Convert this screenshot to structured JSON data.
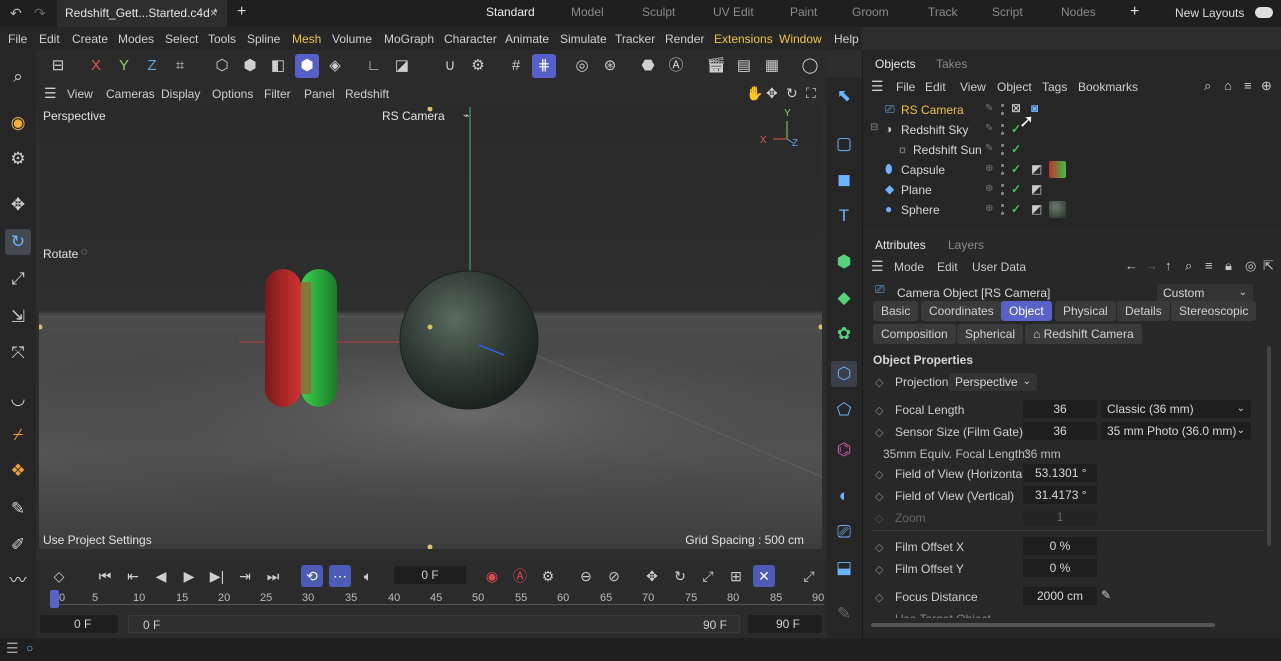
{
  "titlebar": {
    "doc_tab": "Redshift_Gett...Started.c4d *",
    "close": "×",
    "add": "+",
    "workspaces": [
      "Standard",
      "Model",
      "Sculpt",
      "UV Edit",
      "Paint",
      "Groom",
      "Track",
      "Script",
      "Nodes"
    ],
    "active_workspace": "Standard",
    "new_layouts": "New Layouts"
  },
  "menubar": [
    "File",
    "Edit",
    "Create",
    "Modes",
    "Select",
    "Tools",
    "Spline",
    "Mesh",
    "Volume",
    "MoGraph",
    "Character",
    "Animate",
    "Simulate",
    "Tracker",
    "Render",
    "Extensions",
    "Window",
    "Help"
  ],
  "viewport": {
    "menus": [
      "View",
      "Cameras",
      "Display",
      "Options",
      "Filter",
      "Panel",
      "Redshift"
    ],
    "label": "Perspective",
    "camera": "RS Camera",
    "hud_rotate": "Rotate",
    "projection_note": "Use Project Settings",
    "grid_spacing": "Grid Spacing : 500 cm",
    "axis": {
      "x": "X",
      "y": "Y",
      "z": "Z"
    },
    "toolbar_axes": [
      "X",
      "Y",
      "Z"
    ]
  },
  "timeline": {
    "current_frame": "0 F",
    "start": "0 F",
    "preview_start": "0 F",
    "preview_end": "90 F",
    "end": "90 F",
    "ruler": [
      "0",
      "5",
      "10",
      "15",
      "20",
      "25",
      "30",
      "35",
      "40",
      "45",
      "50",
      "55",
      "60",
      "65",
      "70",
      "75",
      "80",
      "85",
      "90"
    ]
  },
  "objects_panel": {
    "tabs": [
      "Objects",
      "Takes"
    ],
    "menus": [
      "File",
      "Edit",
      "View",
      "Object",
      "Tags",
      "Bookmarks"
    ],
    "rows": [
      {
        "name": "RS Camera",
        "selected": true
      },
      {
        "name": "Redshift Sky"
      },
      {
        "name": "Redshift Sun"
      },
      {
        "name": "Capsule"
      },
      {
        "name": "Plane"
      },
      {
        "name": "Sphere"
      }
    ]
  },
  "attributes_panel": {
    "tabs": [
      "Attributes",
      "Layers"
    ],
    "menus": [
      "Mode",
      "Edit",
      "User Data"
    ],
    "object_title": "Camera Object [RS Camera]",
    "preset": "Custom",
    "tab_buttons_row1": [
      "Basic",
      "Coordinates",
      "Object",
      "Physical",
      "Details",
      "Stereoscopic"
    ],
    "active_tab": "Object",
    "tab_buttons_row2": [
      "Composition",
      "Spherical",
      "Redshift Camera"
    ],
    "section": "Object Properties",
    "projection_label": "Projection",
    "projection_value": "Perspective",
    "focal_length_label": "Focal Length",
    "focal_length": "36",
    "focal_preset": "Classic (36 mm)",
    "sensor_label": "Sensor Size (Film Gate)",
    "sensor": "36",
    "sensor_preset": "35 mm Photo (36.0 mm)",
    "equiv_label": "35mm Equiv. Focal Length:",
    "equiv_value": "36 mm",
    "fov_h_label": "Field of View (Horizontal)",
    "fov_h": "53.1301 °",
    "fov_v_label": "Field of View (Vertical)",
    "fov_v": "31.4173 °",
    "zoom_label": "Zoom",
    "zoom": "1",
    "film_x_label": "Film Offset X",
    "film_x": "0 %",
    "film_y_label": "Film Offset Y",
    "film_y": "0 %",
    "focus_label": "Focus Distance",
    "focus": "2000 cm",
    "target_label": "Use Target Object"
  },
  "colors": {
    "accent": "#5862c7",
    "highlight": "#f0c24a",
    "check": "#46c25a",
    "icon_blue": "#6cb4ff"
  }
}
